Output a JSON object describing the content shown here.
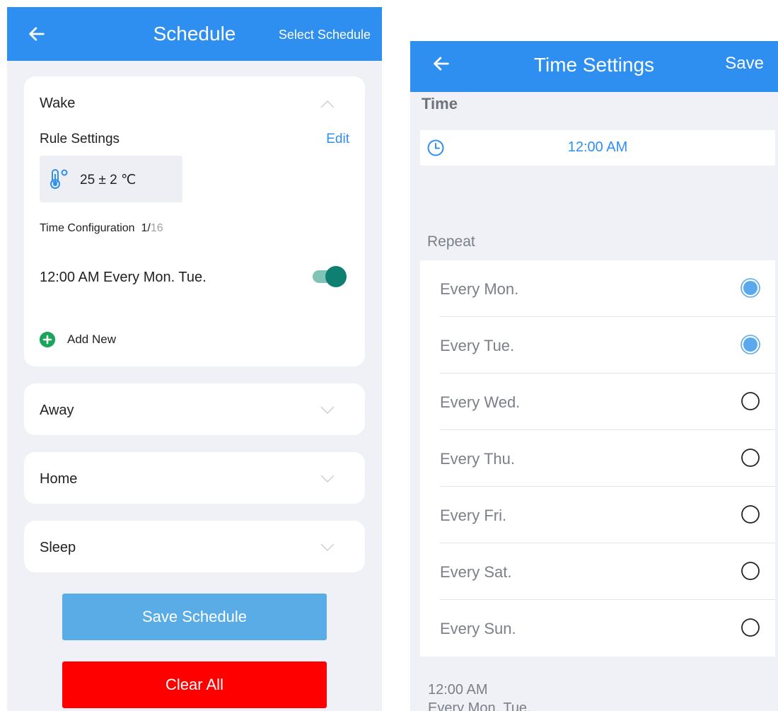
{
  "schedule_screen": {
    "title": "Schedule",
    "select_schedule_label": "Select Schedule",
    "wake": {
      "title": "Wake",
      "rule_settings_label": "Rule Settings",
      "edit_label": "Edit",
      "temperature_text": "25 ± 2 ℃",
      "time_config_label": "Time Configuration",
      "time_config_current": "1/",
      "time_config_total": "16",
      "entry_text": "12:00 AM Every Mon. Tue.",
      "entry_enabled": true,
      "add_new_label": "Add New"
    },
    "sections": [
      {
        "title": "Away"
      },
      {
        "title": "Home"
      },
      {
        "title": "Sleep"
      }
    ],
    "save_button_label": "Save Schedule",
    "clear_button_label": "Clear All",
    "colors": {
      "header": "#2f8ff0",
      "save_button": "#5aace6",
      "clear_button": "#ff0000",
      "toggle": "#0f7f72",
      "add_icon": "#19a55a"
    }
  },
  "time_settings_screen": {
    "title": "Time Settings",
    "save_label": "Save",
    "time_section_label": "Time",
    "time_value": "12:00 AM",
    "repeat_section_label": "Repeat",
    "days": [
      {
        "label": "Every Mon.",
        "selected": true
      },
      {
        "label": "Every Tue.",
        "selected": true
      },
      {
        "label": "Every Wed.",
        "selected": false
      },
      {
        "label": "Every Thu.",
        "selected": false
      },
      {
        "label": "Every Fri.",
        "selected": false
      },
      {
        "label": "Every Sat.",
        "selected": false
      },
      {
        "label": "Every Sun.",
        "selected": false
      }
    ],
    "summary_time": "12:00 AM",
    "summary_days": "Every Mon. Tue.",
    "colors": {
      "accent": "#2f8ff0",
      "selected_radio": "#5aa9ee"
    }
  }
}
